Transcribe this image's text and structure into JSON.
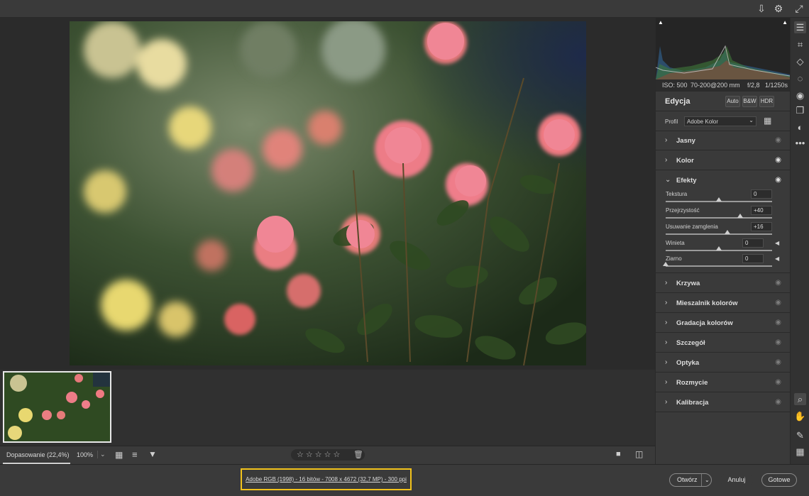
{
  "header": {
    "export_icon": "export-icon",
    "settings_icon": "gear-icon",
    "expand_icon": "expand-icon"
  },
  "exif": {
    "iso": "ISO: 500",
    "lens": "70-200@200 mm",
    "aperture": "f/2,8",
    "shutter": "1/1250s"
  },
  "edit": {
    "title": "Edycja",
    "auto_label": "Auto",
    "bw_label": "B&W",
    "hdr_label": "HDR",
    "profile_label": "Profil",
    "profile_value": "Adobe Kolor"
  },
  "sections": [
    {
      "label": "Jasny",
      "expanded": false,
      "eye_active": false
    },
    {
      "label": "Kolor",
      "expanded": false,
      "eye_active": true
    },
    {
      "label": "Efekty",
      "expanded": true,
      "eye_active": true
    },
    {
      "label": "Krzywa",
      "expanded": false,
      "eye_active": false
    },
    {
      "label": "Mieszalnik kolorów",
      "expanded": false,
      "eye_active": false
    },
    {
      "label": "Gradacja kolorów",
      "expanded": false,
      "eye_active": false
    },
    {
      "label": "Szczegół",
      "expanded": false,
      "eye_active": false
    },
    {
      "label": "Optyka",
      "expanded": false,
      "eye_active": false
    },
    {
      "label": "Rozmycie",
      "expanded": false,
      "eye_active": false
    },
    {
      "label": "Kalibracja",
      "expanded": false,
      "eye_active": false
    }
  ],
  "effects": [
    {
      "name": "Tekstura",
      "value": "0",
      "level": 0.5
    },
    {
      "name": "Przejrzystość",
      "value": "+40",
      "level": 0.7
    },
    {
      "name": "Usuwanie zamglenia",
      "value": "+16",
      "level": 0.58
    },
    {
      "name": "Winieta",
      "value": "0",
      "level": 0.5
    },
    {
      "name": "Ziarno",
      "value": "0",
      "level": 0.0
    }
  ],
  "bottombar": {
    "zoom_fit": "Dopasowanie (22,4%)",
    "zoom_100": "100%",
    "rating_stars": "☆☆☆☆☆",
    "trash_icon": "trash-icon"
  },
  "footer": {
    "file_info": "Adobe RGB (1998) - 16 bitów - 7008 x 4672 (32,7 MP) - 300 ppi",
    "open_label": "Otwórz",
    "cancel_label": "Anuluj",
    "done_label": "Gotowe"
  },
  "colors": {
    "accent": "#f2c21b",
    "panel": "#3a3a3a",
    "background": "#2b2b2b"
  }
}
